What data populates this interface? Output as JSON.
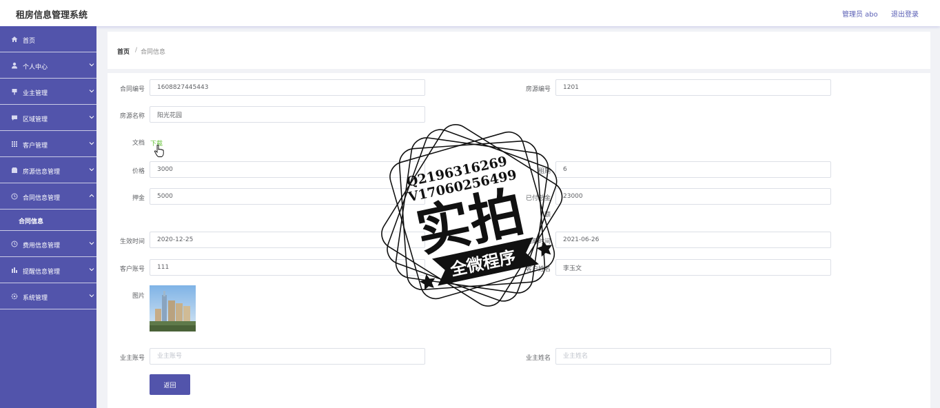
{
  "header": {
    "title": "租房信息管理系统",
    "admin": "管理员 abo",
    "logout": "退出登录"
  },
  "sidebar": {
    "items": [
      {
        "label": "首页",
        "icon": "home-icon"
      },
      {
        "label": "个人中心",
        "icon": "user-icon"
      },
      {
        "label": "业主管理",
        "icon": "pin-icon"
      },
      {
        "label": "区域管理",
        "icon": "chat-icon"
      },
      {
        "label": "客户管理",
        "icon": "grid-icon"
      },
      {
        "label": "房源信息管理",
        "icon": "box-icon"
      },
      {
        "label": "合同信息管理",
        "icon": "clock-icon"
      },
      {
        "label": "合同信息"
      },
      {
        "label": "费用信息管理",
        "icon": "clock-icon"
      },
      {
        "label": "提醒信息管理",
        "icon": "chart-icon"
      },
      {
        "label": "系统管理",
        "icon": "gear-icon"
      }
    ]
  },
  "breadcrumb": {
    "home": "首页",
    "separator": "/",
    "current": "合同信息"
  },
  "form": {
    "contract_no": {
      "label": "合同编号",
      "value": "1608827445443"
    },
    "house_no": {
      "label": "房源编号",
      "value": "1201"
    },
    "house_name": {
      "label": "房源名称",
      "value": "阳光花园"
    },
    "document": {
      "label": "文档",
      "link": "下载"
    },
    "price": {
      "label": "价格",
      "value": "3000"
    },
    "lease_term": {
      "label": "租期",
      "value": "6"
    },
    "deposit": {
      "label": "押金",
      "value": "5000"
    },
    "total_paid": {
      "label_line1": "已付总金",
      "label_line2": "额",
      "value": "23000"
    },
    "start_date": {
      "label": "生效时间",
      "value": "2020-12-25"
    },
    "end_date": {
      "label": "到期时间",
      "value": "2021-06-26"
    },
    "customer_account": {
      "label": "客户账号",
      "value": "111"
    },
    "customer_name": {
      "label": "客户姓名",
      "value": "李玉文"
    },
    "picture": {
      "label": "图片"
    },
    "owner_account": {
      "label": "业主账号",
      "placeholder": "业主账号"
    },
    "owner_name": {
      "label": "业主姓名",
      "placeholder": "业主姓名"
    },
    "back_button": "返回"
  },
  "watermark": {
    "line1": "Q2196316269",
    "line2": "V17060256499",
    "main": "实拍",
    "banner": "全微程序"
  }
}
